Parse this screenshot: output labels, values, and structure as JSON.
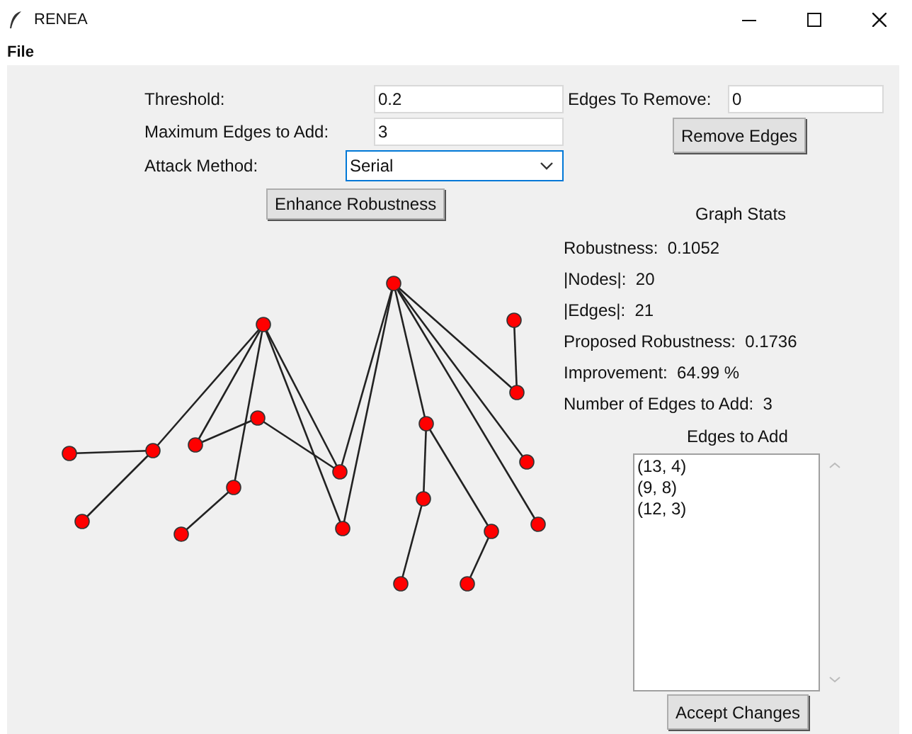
{
  "window": {
    "title": "RENEA"
  },
  "menu": [
    "File"
  ],
  "form": {
    "threshold": {
      "label": "Threshold:",
      "value": "0.2"
    },
    "max_edges": {
      "label": "Maximum Edges to Add:",
      "value": "3"
    },
    "attack_method": {
      "label": "Attack Method:",
      "value": "Serial",
      "focused": true
    },
    "enhance_button": "Enhance Robustness"
  },
  "remove": {
    "label": "Edges To Remove:",
    "value": "0",
    "button": "Remove Edges"
  },
  "stats": {
    "title": "Graph Stats",
    "items": [
      {
        "label": "Robustness:",
        "value": "0.1052"
      },
      {
        "label": "|Nodes|:",
        "value": "20"
      },
      {
        "label": "|Edges|:",
        "value": "21"
      },
      {
        "label": "Proposed Robustness:",
        "value": "0.1736"
      },
      {
        "label": "Improvement:",
        "value": "64.99 %"
      },
      {
        "label": "Number of Edges to Add:",
        "value": "3"
      }
    ]
  },
  "edges_to_add": {
    "title": "Edges to Add",
    "items": [
      {
        "text": "(13, 4)",
        "selected": false
      },
      {
        "text": "(9, 8)",
        "selected": false
      },
      {
        "text": "(12, 3)",
        "selected": false
      }
    ]
  },
  "accept_button": "Accept Changes"
}
